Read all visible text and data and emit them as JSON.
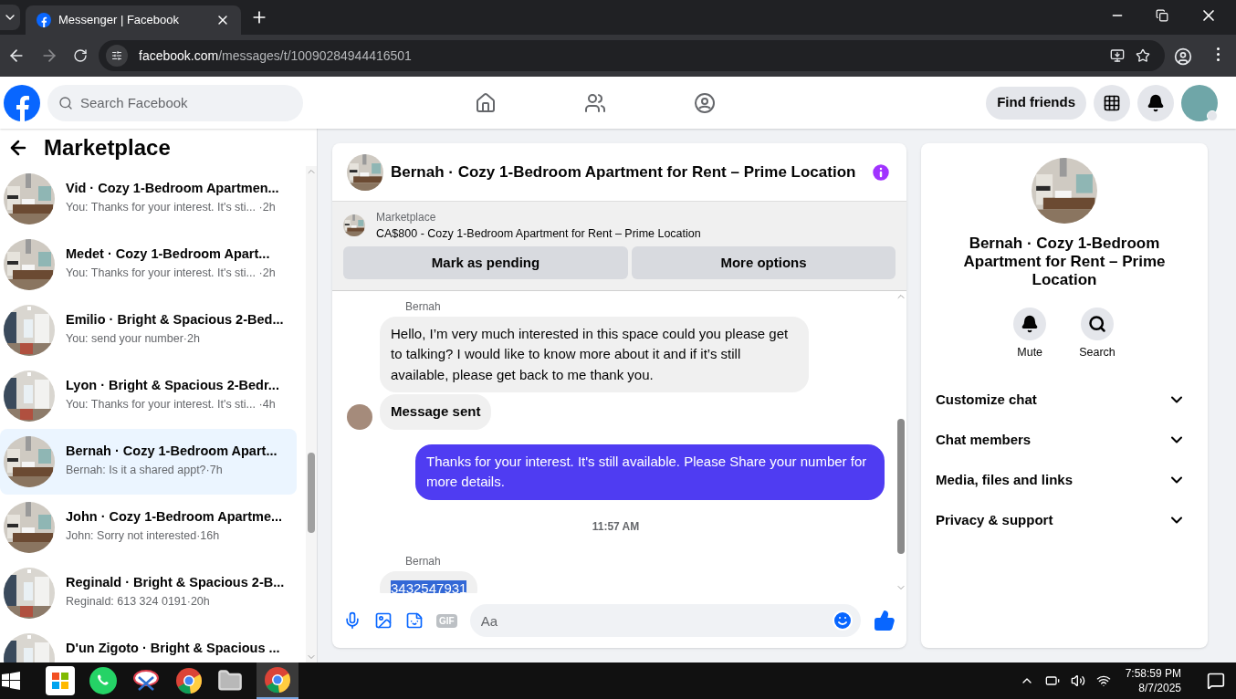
{
  "browser": {
    "tab_title": "Messenger | Facebook",
    "url_host": "facebook.com",
    "url_path": "/messages/t/10090284944416501"
  },
  "header": {
    "search": {
      "placeholder": "Search Facebook"
    },
    "find_friends": "Find friends"
  },
  "sidebar": {
    "title": "Marketplace",
    "conversations": [
      {
        "title": "Vid · Cozy 1-Bedroom Apartmen...",
        "preview": "You: Thanks for your interest. It's sti... ·2h",
        "selected": false
      },
      {
        "title": "Medet · Cozy 1-Bedroom Apart...",
        "preview": "You: Thanks for your interest. It's sti... ·2h",
        "selected": false
      },
      {
        "title": "Emilio · Bright & Spacious 2-Bed...",
        "preview": "You: send your number·2h",
        "selected": false
      },
      {
        "title": "Lyon · Bright & Spacious 2-Bedr...",
        "preview": "You: Thanks for your interest. It's sti... ·4h",
        "selected": false
      },
      {
        "title": "Bernah · Cozy 1-Bedroom Apart...",
        "preview": "Bernah: Is it a shared appt?·7h",
        "selected": true
      },
      {
        "title": "John · Cozy 1-Bedroom Apartme...",
        "preview": "John: Sorry not interested·16h",
        "selected": false
      },
      {
        "title": "Reginald · Bright & Spacious 2-B...",
        "preview": "Reginald: 613 324 0191·20h",
        "selected": false
      },
      {
        "title": "D'un Zigoto · Bright & Spacious ...",
        "selected": false
      }
    ]
  },
  "chat": {
    "title": "Bernah · Cozy 1-Bedroom Apartment for Rent – Prime Location",
    "listing": {
      "label": "Marketplace",
      "text": "CA$800 - Cozy 1-Bedroom Apartment for Rent – Prime Location",
      "buttons": [
        "Mark as pending",
        "More options"
      ]
    },
    "messages": [
      {
        "kind": "sender",
        "text": "Bernah"
      },
      {
        "kind": "incoming",
        "text": "Hello, I’m very much interested in this space could you please get to talking? I would like to know more about it and if it’s still available, please get back to me thank you.",
        "avatar": false,
        "bold": false,
        "highlighted": false
      },
      {
        "kind": "incoming",
        "text": "Message sent",
        "avatar": true,
        "bold": true,
        "highlighted": false
      },
      {
        "kind": "outgoing",
        "text": "Thanks for your interest.  It's still available. Please Share your number for more details."
      },
      {
        "kind": "time",
        "text": "11:57 AM"
      },
      {
        "kind": "sender",
        "text": "Bernah"
      },
      {
        "kind": "incoming",
        "text": "3432547931",
        "avatar": false,
        "bold": false,
        "highlighted": true
      }
    ],
    "composer": {
      "placeholder": "Aa",
      "gif": "GIF"
    }
  },
  "details": {
    "title": "Bernah · Cozy 1-Bedroom Apartment for Rent – Prime Location",
    "actions": [
      {
        "kind": "bell",
        "label": "Mute"
      },
      {
        "kind": "search",
        "label": "Search"
      }
    ],
    "sections": [
      {
        "label": "Customize chat",
        "expanded": false
      },
      {
        "label": "Chat members",
        "expanded": false
      },
      {
        "label": "Media, files and links",
        "expanded": false
      },
      {
        "label": "Privacy & support",
        "expanded": false
      }
    ]
  },
  "taskbar": {
    "time": "7:58:59 PM",
    "date": "8/7/2025"
  }
}
